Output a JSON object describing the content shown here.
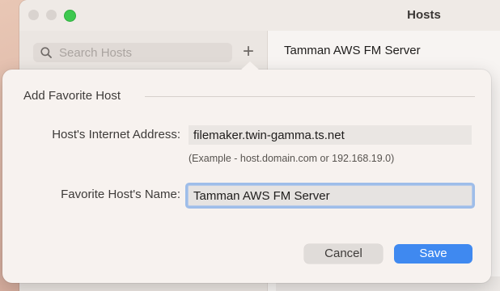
{
  "window": {
    "title": "Hosts"
  },
  "sidebar": {
    "search": {
      "placeholder": "Search Hosts",
      "value": ""
    },
    "add_button": "+"
  },
  "host_pane": {
    "selected_host": "Tamman AWS FM Server"
  },
  "dialog": {
    "title": "Add Favorite Host",
    "address_label": "Host's Internet Address:",
    "address_value": "filemaker.twin-gamma.ts.net",
    "address_hint": "(Example - host.domain.com or 192.168.19.0)",
    "name_label": "Favorite Host's Name:",
    "name_value": "Tamman AWS FM Server",
    "cancel_label": "Cancel",
    "save_label": "Save"
  },
  "colors": {
    "accent": "#3f89f0",
    "zoom_button": "#3ec84f",
    "focus_ring": "#9ebde9"
  },
  "icons": {
    "search": "search-icon",
    "add": "plus-icon"
  }
}
